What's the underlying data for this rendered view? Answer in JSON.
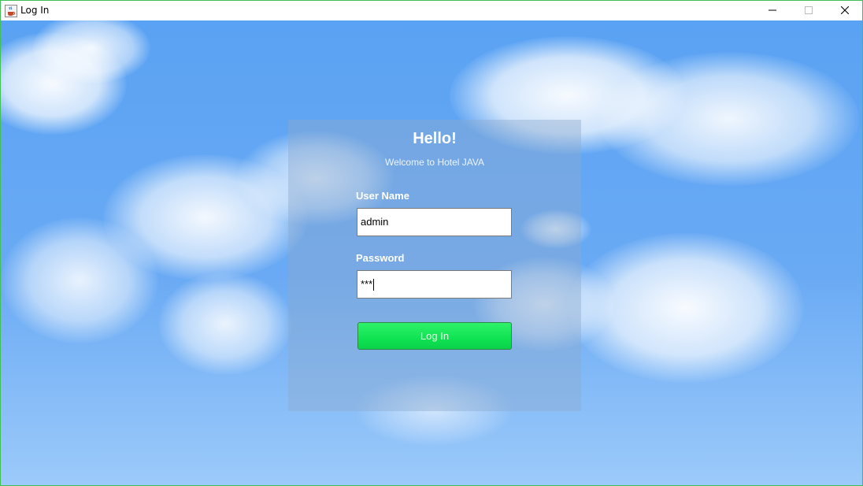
{
  "window": {
    "title": "Log In",
    "app_icon": "java-cup-icon",
    "controls": {
      "minimize_icon": "minimize-icon",
      "maximize_icon": "maximize-icon",
      "close_icon": "close-icon"
    }
  },
  "login": {
    "heading": "Hello!",
    "subtitle": "Welcome to Hotel  JAVA",
    "username_label": "User Name",
    "username_value": "admin",
    "password_label": "Password",
    "password_value": "***",
    "login_button_label": "Log In"
  },
  "colors": {
    "sky_top": "#5aa2f3",
    "sky_bottom": "#9ccafa",
    "button_green": "#0fe352",
    "window_border": "#3fbf55"
  }
}
